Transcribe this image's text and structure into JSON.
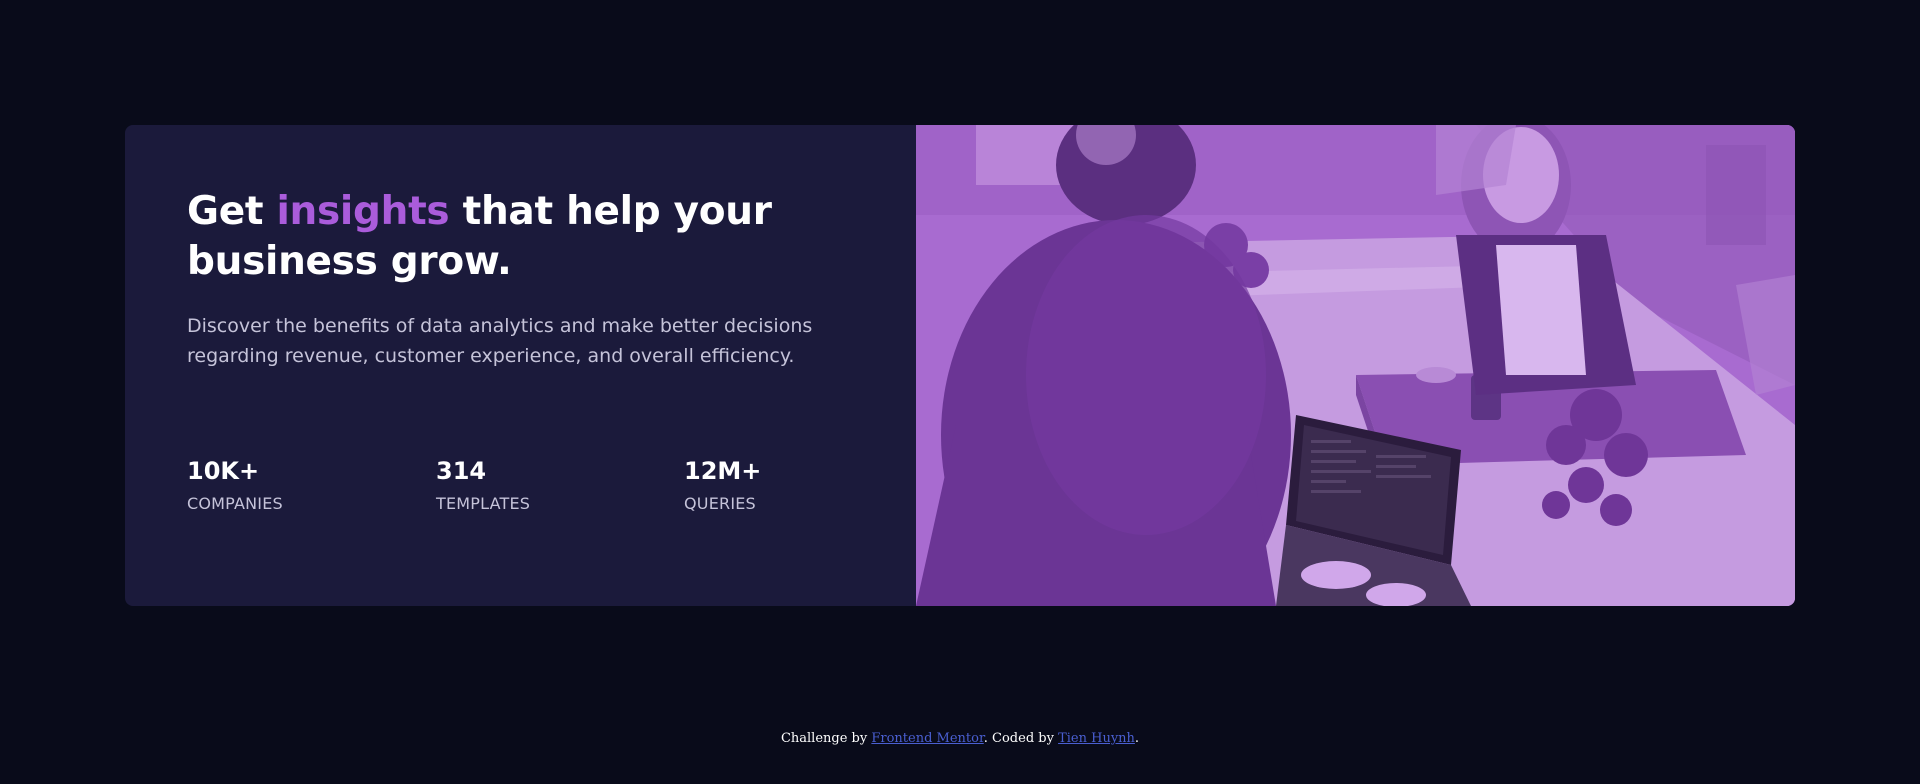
{
  "card": {
    "headline": {
      "part1": "Get ",
      "accent": "insights",
      "part2": " that help your business grow."
    },
    "description": "Discover the benefits of data analytics and make better decisions regarding revenue, customer experience, and overall efficiency.",
    "stats": [
      {
        "value": "10K+",
        "label": "COMPANIES"
      },
      {
        "value": "314",
        "label": "TEMPLATES"
      },
      {
        "value": "12M+",
        "label": "QUERIES"
      }
    ]
  },
  "footer": {
    "prefix": "Challenge by ",
    "challenge_link": "Frontend Mentor",
    "middle": ". Coded by ",
    "author_link": "Tien Huynh",
    "suffix": "."
  },
  "colors": {
    "page_background": "#090b1a",
    "card_background": "#1b1a3b",
    "accent": "#aa5cdb",
    "image_tint": "#a86bd0",
    "body_text": "#c5c3d9",
    "link": "#4a5fd1"
  }
}
